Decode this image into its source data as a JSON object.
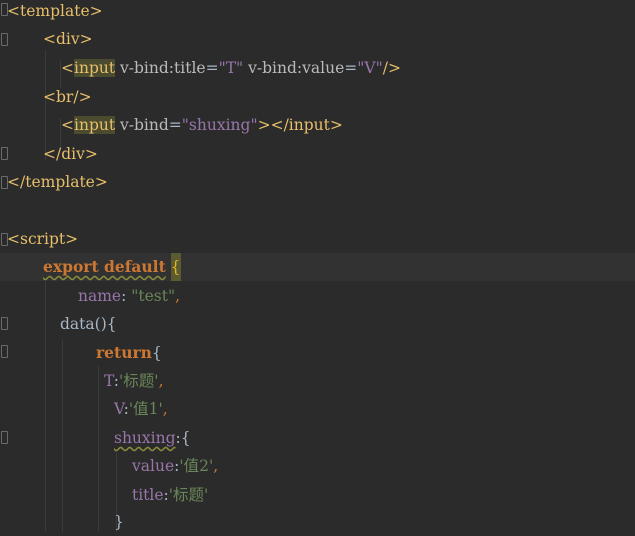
{
  "editor": {
    "lines": {
      "l1": {
        "open": "<",
        "tag": "template",
        "close": ">"
      },
      "l2": {
        "open": "<",
        "tag": "div",
        "close": ">"
      },
      "l3": {
        "open": "<",
        "tag": "input",
        "attr1": "v-bind:",
        "attr1b": "title",
        "eq1": "=",
        "val1": "\"T\"",
        "attr2": "v-bind:",
        "attr2b": "value",
        "eq2": "=",
        "val2": "\"V\"",
        "close": "/>"
      },
      "l4": {
        "open": "<",
        "tag": "br",
        "close": "/>"
      },
      "l5": {
        "open": "<",
        "tag": "input",
        "attr1": "v-bind",
        "eq1": "=",
        "val1": "\"shuxing\"",
        "close": ">",
        "endtag": "</input>"
      },
      "l6": {
        "open": "</",
        "tag": "div",
        "close": ">"
      },
      "l7": {
        "open": "</",
        "tag": "template",
        "close": ">"
      },
      "l9": {
        "open": "<",
        "tag": "script",
        "close": ">"
      },
      "l10": {
        "kw": "export default",
        "brace": "{"
      },
      "l11": {
        "key": "name",
        "colon": ":",
        "val": "\"test\"",
        "comma": ","
      },
      "l12": {
        "fn": "data",
        "paren": "(){"
      },
      "l13": {
        "kw": "return",
        "brace": "{"
      },
      "l14": {
        "key": "T",
        "colon": ":",
        "val": "'标题'",
        "comma": ","
      },
      "l15": {
        "key": "V",
        "colon": ":",
        "val": "'值1'",
        "comma": ","
      },
      "l16": {
        "key": "shuxing",
        "colon": ":",
        "brace": "{"
      },
      "l17": {
        "key": "value",
        "colon": ":",
        "val": "'值2'",
        "comma": ","
      },
      "l18": {
        "key": "title",
        "colon": ":",
        "val": "'标题'"
      },
      "l19": {
        "brace": "}"
      }
    }
  }
}
